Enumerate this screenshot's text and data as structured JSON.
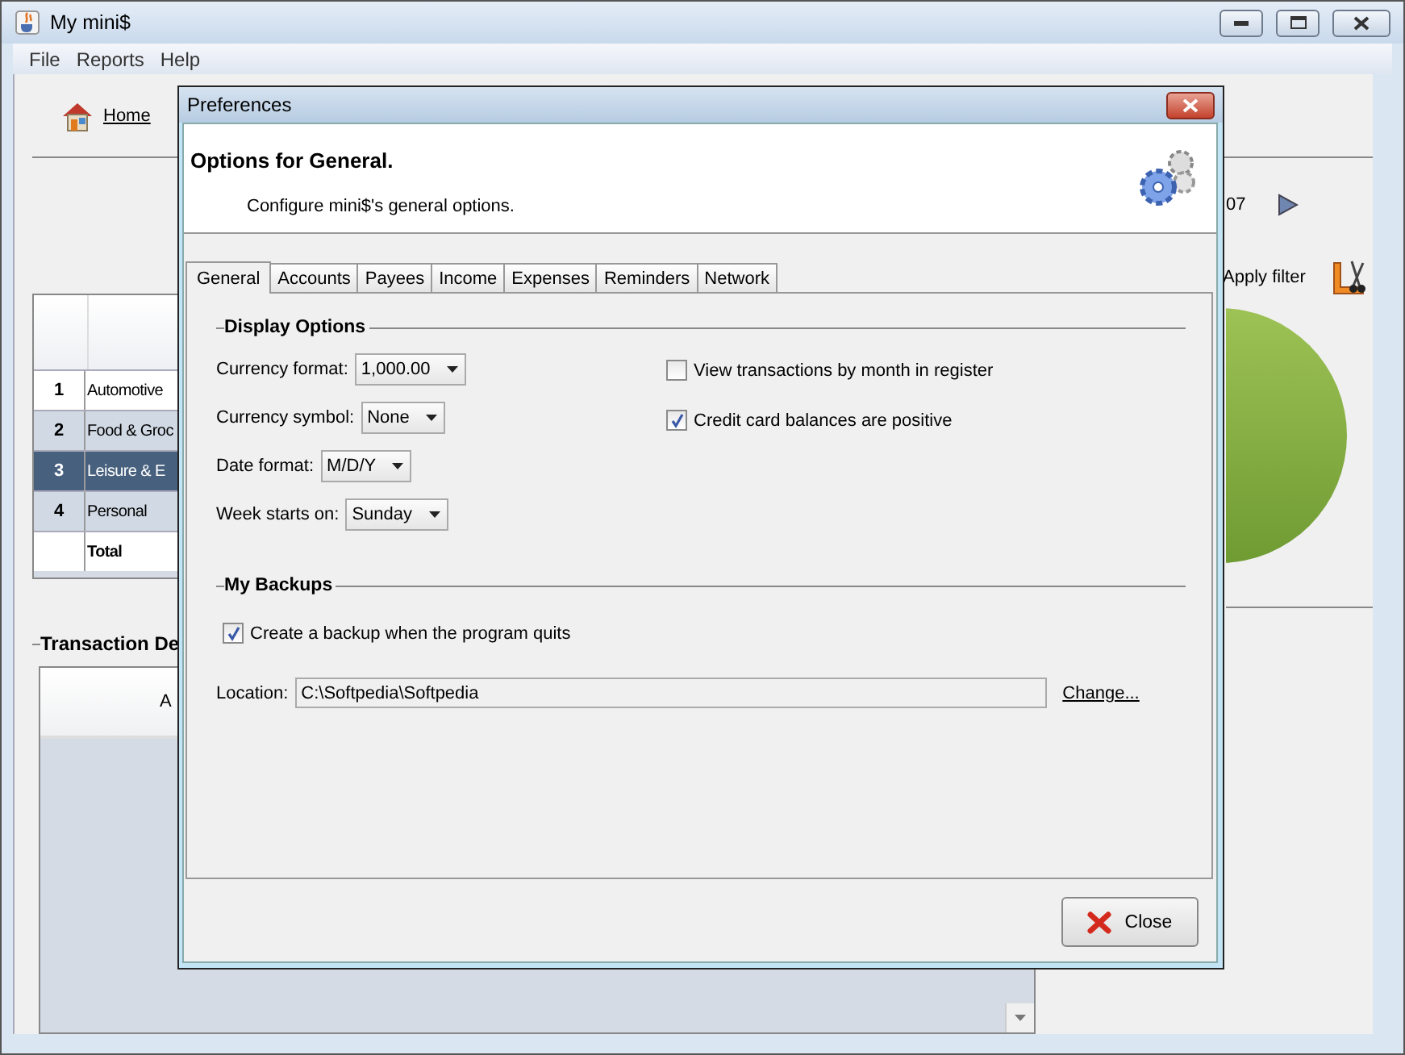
{
  "window": {
    "title": "My mini$",
    "menu": [
      "File",
      "Reports",
      "Help"
    ]
  },
  "toolbar": {
    "home_link": "Home"
  },
  "summary_table": {
    "rows": [
      {
        "number": "1",
        "name": "Automotive",
        "selected": false
      },
      {
        "number": "2",
        "name": "Food & Groc",
        "selected": false
      },
      {
        "number": "3",
        "name": "Leisure & E",
        "selected": true
      },
      {
        "number": "4",
        "name": "Personal",
        "selected": false
      },
      {
        "name": "Total",
        "selected": false,
        "kind": "total"
      }
    ]
  },
  "transactions": {
    "title": "Transaction De",
    "columns": [
      "A"
    ]
  },
  "period": {
    "text": "07"
  },
  "filter": {
    "label": "Apply filter"
  },
  "dialog": {
    "title": "Preferences",
    "heading": "Options for General.",
    "description": "Configure mini$'s general options.",
    "tabs": [
      {
        "label": "General",
        "selected": true
      },
      {
        "label": "Accounts",
        "selected": false
      },
      {
        "label": "Payees",
        "selected": false
      },
      {
        "label": "Income",
        "selected": false
      },
      {
        "label": "Expenses",
        "selected": false
      },
      {
        "label": "Reminders",
        "selected": false
      },
      {
        "label": "Network",
        "selected": false
      }
    ],
    "display_options": {
      "title": "Display Options",
      "dropdowns": [
        {
          "label": "Currency format:",
          "value": "1,000.00"
        },
        {
          "label": "Currency symbol:",
          "value": "None"
        },
        {
          "label": "Date format:",
          "value": "M/D/Y"
        },
        {
          "label": "Week starts on:",
          "value": "Sunday"
        }
      ],
      "checkboxes": [
        {
          "label": "View transactions by month in register",
          "checked": false
        },
        {
          "label": "Credit card balances are positive",
          "checked": true
        }
      ]
    },
    "backups": {
      "title": "My Backups",
      "checkboxes": [
        {
          "label": "Create a backup when the program quits",
          "checked": true
        }
      ],
      "location": {
        "label": "Location:",
        "value": "C:\\Softpedia\\Softpedia",
        "link": "Change..."
      }
    },
    "close_button": "Close"
  }
}
